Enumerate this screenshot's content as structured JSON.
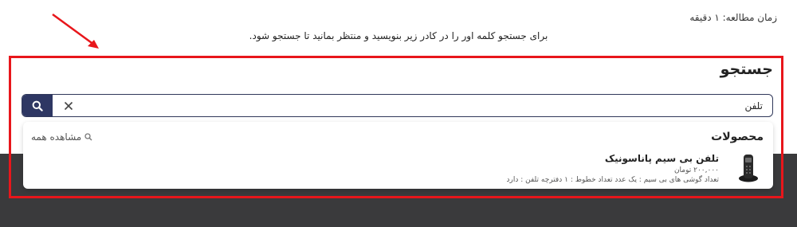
{
  "header": {
    "reading_time": "زمان مطالعه: ۱ دقیقه",
    "instruction": "برای جستجو کلمه اور را در کادر زیر بنویسید و منتظر بمانید تا جستجو شود."
  },
  "search": {
    "title": "جستجو",
    "value": "تلفن",
    "search_icon": "magnifier-icon",
    "clear_icon": "close-icon",
    "button_color": "#2e3763"
  },
  "results": {
    "heading": "محصولات",
    "view_all_label": "مشاهده همه",
    "products": [
      {
        "name": "تلفن بی سیم پاناسونیک",
        "price": "۲۰۰,۰۰۰ تومان",
        "description": "تعداد گوشی های بی سیم : یک عدد تعداد خطوط : ۱ دفترچه تلفن : دارد"
      }
    ]
  },
  "annotation": {
    "frame_color": "#e8161b",
    "arrow_color": "#e8161b"
  }
}
